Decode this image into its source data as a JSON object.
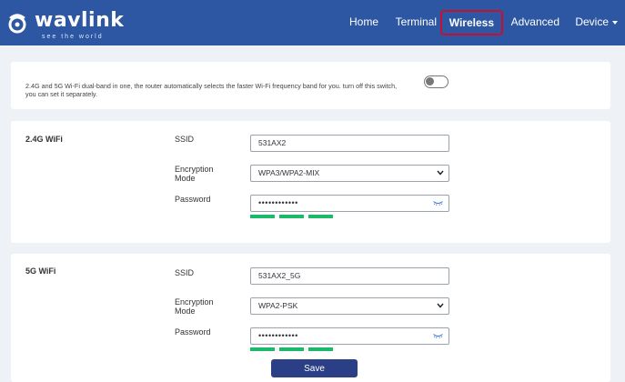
{
  "header": {
    "logo_text": "wavlink",
    "logo_tagline": "see the world",
    "nav": [
      "Home",
      "Terminal",
      "Wireless",
      "Advanced",
      "Device"
    ],
    "active_nav": "Wireless",
    "device_dropdown_icon": "caret-down-icon"
  },
  "dual_band": {
    "description": "2.4G and 5G Wi-Fi dual-band in one, the router automatically selects the faster Wi-Fi frequency band for you. turn off this switch, you can set it separately.",
    "toggle_on": false
  },
  "wifi_24": {
    "title": "2.4G WiFi",
    "ssid_label": "SSID",
    "ssid_value": "531AX2",
    "encryption_label_line1": "Encryption",
    "encryption_label_line2": "Mode",
    "encryption_value": "WPA3/WPA2-MIX",
    "password_label": "Password",
    "password_value": "••••••••••••",
    "strength_bars": 3
  },
  "wifi_5": {
    "title": "5G WiFi",
    "ssid_label": "SSID",
    "ssid_value": "531AX2_5G",
    "encryption_label_line1": "Encryption",
    "encryption_label_line2": "Mode",
    "encryption_value": "WPA2-PSK",
    "password_label": "Password",
    "password_value": "••••••••••••",
    "strength_bars": 3
  },
  "save_label": "Save",
  "colors": {
    "header_bg": "#2d57a3",
    "active_outline": "#c8102e",
    "strength": "#1aba6a",
    "save_bg": "#2b3f86"
  }
}
